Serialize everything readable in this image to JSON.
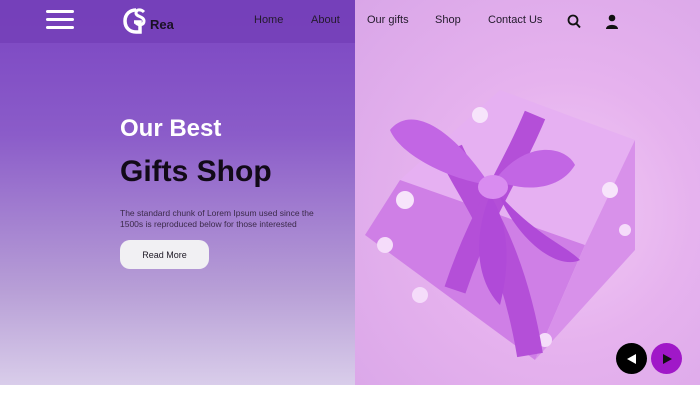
{
  "brand": {
    "name": "Rea",
    "monogram": "GS"
  },
  "nav": {
    "items": [
      {
        "label": "Home"
      },
      {
        "label": "About"
      },
      {
        "label": "Our gifts"
      },
      {
        "label": "Shop"
      },
      {
        "label": "Contact Us"
      }
    ]
  },
  "icons": {
    "menu": "hamburger-icon",
    "search": "search-icon",
    "user": "user-icon",
    "prev": "triangle-left-icon",
    "next": "triangle-right-icon"
  },
  "hero": {
    "heading_line1": "Our Best",
    "heading_line2": "Gifts Shop",
    "description": "The standard chunk of Lorem Ipsum used since the 1500s is reproduced below for those interested",
    "cta_label": "Read More"
  },
  "colors": {
    "primary": "#7a44c2",
    "accent": "#a018c8",
    "dark": "#120a18"
  }
}
